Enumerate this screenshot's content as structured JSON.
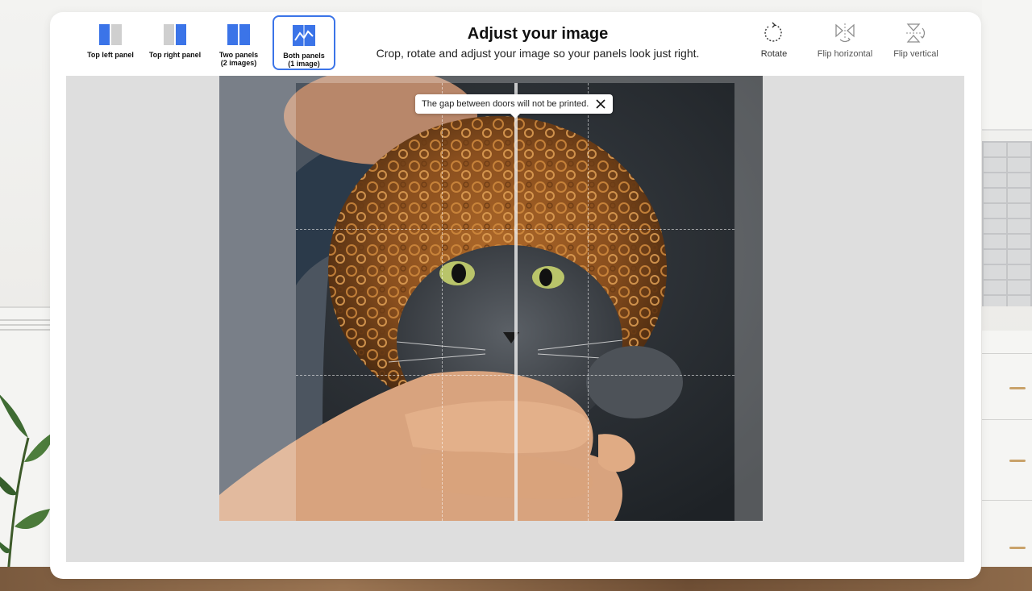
{
  "layouts": [
    {
      "label": "Top left panel",
      "selected": false
    },
    {
      "label": "Top right panel",
      "selected": false
    },
    {
      "label": "Two panels\n(2 images)",
      "selected": false
    },
    {
      "label": "Both panels\n(1 image)",
      "selected": true
    }
  ],
  "header": {
    "title": "Adjust your image",
    "subtitle": "Crop, rotate and adjust your image so your panels look just right."
  },
  "tools": {
    "rotate": "Rotate",
    "flip_horizontal": "Flip horizontal",
    "flip_vertical": "Flip vertical"
  },
  "editor": {
    "tooltip": "The gap between doors will not be printed."
  },
  "colors": {
    "accent": "#3b74e8",
    "panel_inactive": "#cfcfcf",
    "editor_bg": "#dedede"
  },
  "icons": {
    "close": "close-icon",
    "rotate": "rotate-icon",
    "flip_horizontal": "flip-horizontal-icon",
    "flip_vertical": "flip-vertical-icon"
  }
}
